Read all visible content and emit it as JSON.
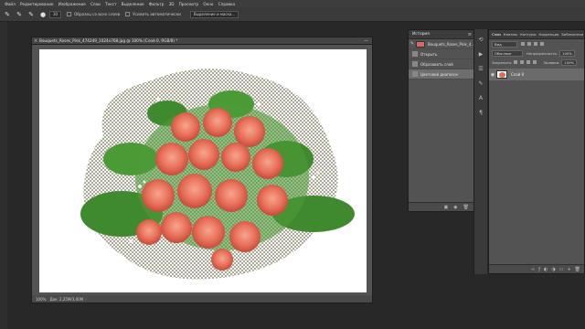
{
  "menu": [
    "Файл",
    "Редактирование",
    "Изображение",
    "Слои",
    "Текст",
    "Выделение",
    "Фильтр",
    "3D",
    "Просмотр",
    "Окно",
    "Справка"
  ],
  "options": {
    "brush_size": "30",
    "sample_all_label": "Образец со всех слоев",
    "auto_enhance_label": "Усилить автоматически",
    "refine_edge_label": "Выделение и маска..."
  },
  "document": {
    "title": "Bouquets_Roses_Pink_474249_1024x768.jpg @ 100% (Слой 0, RGB/8) *",
    "zoom": "100%",
    "doc_info": "Док: 2,25M/3,00M"
  },
  "history": {
    "tab": "История",
    "items": [
      {
        "label": "Bouquets_Roses_Pink_4..."
      },
      {
        "label": "Открыть"
      },
      {
        "label": "Образовать слой"
      },
      {
        "label": "Цветовой диапазон"
      }
    ]
  },
  "layers": {
    "tabs": [
      "Слои",
      "Каналы",
      "Контуры",
      "Коррекция",
      "Библиотеки"
    ],
    "filter_kind": "Вид",
    "blend_mode": "Обычные",
    "opacity_label": "Непрозрачность:",
    "opacity_value": "100%",
    "lock_label": "Закрепить:",
    "fill_label": "Заливка:",
    "fill_value": "100%",
    "layer_name": "Слой 0"
  }
}
